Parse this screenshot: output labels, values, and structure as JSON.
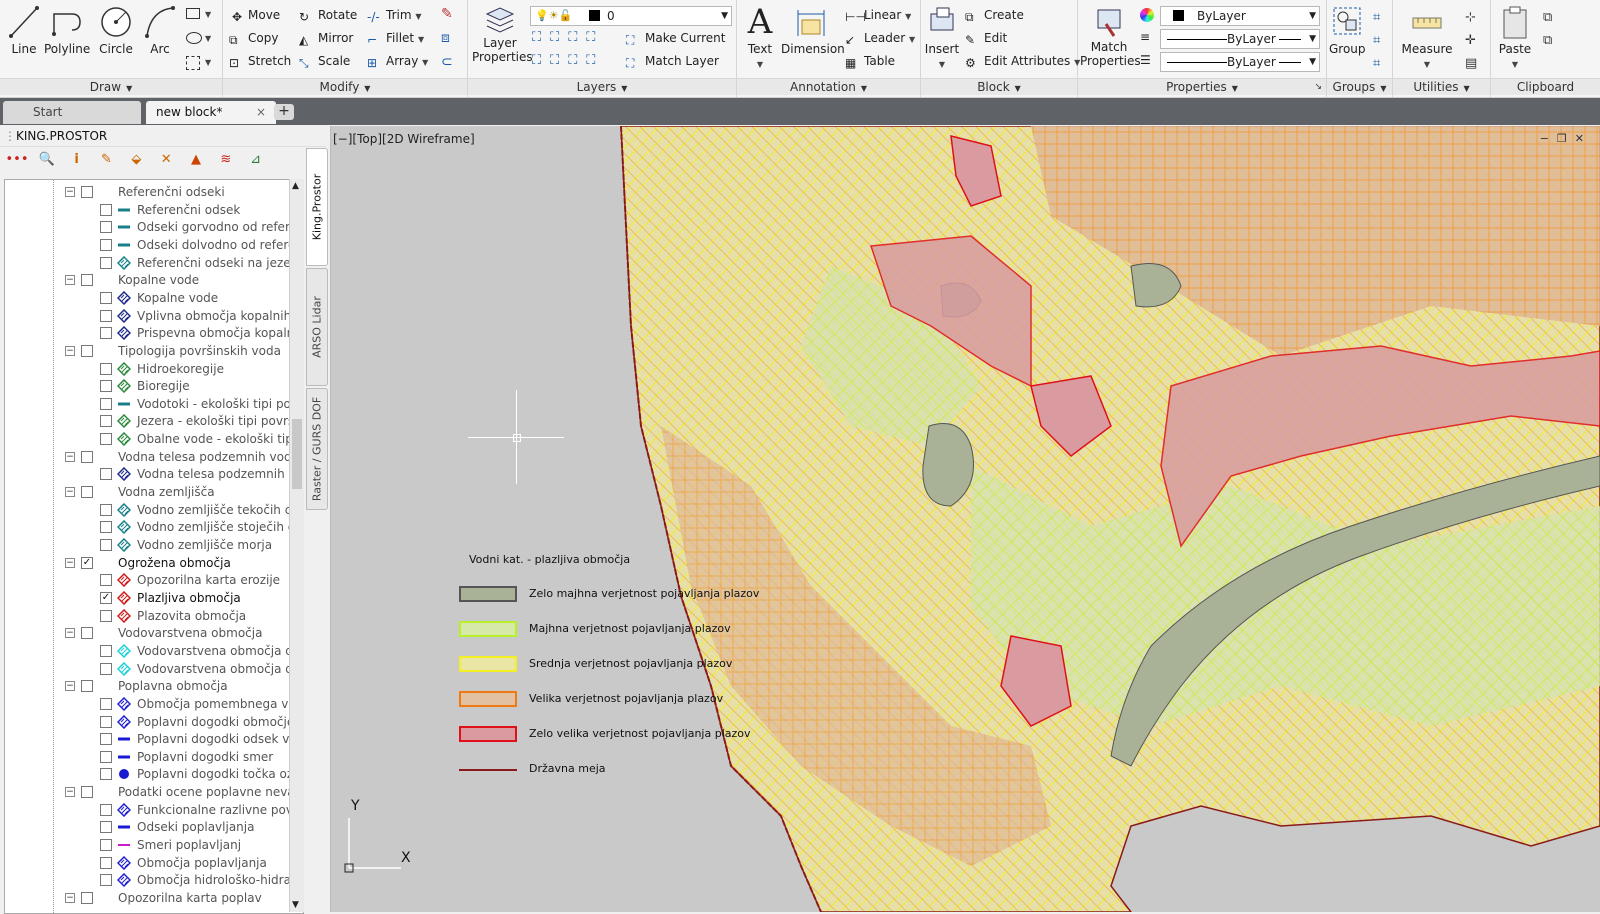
{
  "ribbon": {
    "draw": {
      "title": "Draw",
      "line": "Line",
      "polyline": "Polyline",
      "circle": "Circle",
      "arc": "Arc"
    },
    "modify": {
      "title": "Modify",
      "move": "Move",
      "rotate": "Rotate",
      "trim": "Trim",
      "copy": "Copy",
      "mirror": "Mirror",
      "fillet": "Fillet",
      "stretch": "Stretch",
      "scale": "Scale",
      "array": "Array"
    },
    "layers": {
      "title": "Layers",
      "layer_properties_1": "Layer",
      "layer_properties_2": "Properties",
      "layer_value": "0",
      "make_current": "Make Current",
      "match_layer": "Match Layer"
    },
    "annotation": {
      "title": "Annotation",
      "text": "Text",
      "dimension": "Dimension",
      "linear": "Linear",
      "leader": "Leader",
      "table": "Table"
    },
    "block": {
      "title": "Block",
      "insert": "Insert",
      "create": "Create",
      "edit": "Edit",
      "edit_attributes": "Edit Attributes"
    },
    "properties": {
      "title": "Properties",
      "match_1": "Match",
      "match_2": "Properties",
      "color": "ByLayer",
      "linetype": "ByLayer",
      "lineweight": "ByLayer"
    },
    "groups": {
      "title": "Groups",
      "group": "Group"
    },
    "utilities": {
      "title": "Utilities",
      "measure": "Measure"
    },
    "clipboard": {
      "title": "Clipboard",
      "paste": "Paste"
    }
  },
  "tabs": {
    "start": "Start",
    "new_block": "new block*",
    "close": "×",
    "plus": "+"
  },
  "left_panel": {
    "title": "KING.PROSTOR",
    "side_tabs": [
      "King.Prostor",
      "ARSO Lidar",
      "Raster / GURS DOF"
    ],
    "tree": [
      {
        "label": "Referenčni odseki",
        "level": 0,
        "checked": false,
        "icon": "none"
      },
      {
        "label": "Referenčni odsek",
        "level": 1,
        "checked": false,
        "icon": "line-teal"
      },
      {
        "label": "Odseki gorvodno od referenč",
        "level": 1,
        "checked": false,
        "icon": "line-teal"
      },
      {
        "label": "Odseki dolvodno od referenč",
        "level": 1,
        "checked": false,
        "icon": "line-teal"
      },
      {
        "label": "Referenčni odseki na jezerih",
        "level": 1,
        "checked": false,
        "icon": "hatch-teal"
      },
      {
        "label": "Kopalne vode",
        "level": 0,
        "checked": false,
        "icon": "none"
      },
      {
        "label": "Kopalne vode",
        "level": 1,
        "checked": false,
        "icon": "hatch-navy"
      },
      {
        "label": "Vplivna območja kopalnih vo",
        "level": 1,
        "checked": false,
        "icon": "hatch-navy"
      },
      {
        "label": "Prispevna območja kopalnih",
        "level": 1,
        "checked": false,
        "icon": "hatch-navy"
      },
      {
        "label": "Tipologija površinskih voda",
        "level": 0,
        "checked": false,
        "icon": "none"
      },
      {
        "label": "Hidroekoregije",
        "level": 1,
        "checked": false,
        "icon": "hatch-green"
      },
      {
        "label": "Bioregije",
        "level": 1,
        "checked": false,
        "icon": "hatch-green"
      },
      {
        "label": "Vodotoki - ekološki tipi površ",
        "level": 1,
        "checked": false,
        "icon": "line-teal"
      },
      {
        "label": "Jezera - ekološki tipi površins",
        "level": 1,
        "checked": false,
        "icon": "hatch-green"
      },
      {
        "label": "Obalne vode - ekološki tipi po",
        "level": 1,
        "checked": false,
        "icon": "hatch-green"
      },
      {
        "label": "Vodna telesa podzemnih voda",
        "level": 0,
        "checked": false,
        "icon": "none"
      },
      {
        "label": "Vodna telesa podzemnih vod",
        "level": 1,
        "checked": false,
        "icon": "hatch-navy"
      },
      {
        "label": "Vodna zemljišča",
        "level": 0,
        "checked": false,
        "icon": "none"
      },
      {
        "label": "Vodno zemljišče tekočih celin",
        "level": 1,
        "checked": false,
        "icon": "hatch-teal"
      },
      {
        "label": "Vodno zemljišče stoječih celin",
        "level": 1,
        "checked": false,
        "icon": "hatch-teal"
      },
      {
        "label": "Vodno zemljišče morja",
        "level": 1,
        "checked": false,
        "icon": "hatch-teal"
      },
      {
        "label": "Ogrožena območja",
        "level": 0,
        "checked": true,
        "icon": "none",
        "dark": true
      },
      {
        "label": "Opozorilna karta erozije",
        "level": 1,
        "checked": false,
        "icon": "hatch-red"
      },
      {
        "label": "Plazljiva območja",
        "level": 1,
        "checked": true,
        "icon": "hatch-red",
        "dark": true
      },
      {
        "label": "Plazovita območja",
        "level": 1,
        "checked": false,
        "icon": "hatch-red"
      },
      {
        "label": "Vodovarstvena območja",
        "level": 0,
        "checked": false,
        "icon": "none"
      },
      {
        "label": "Vodovarstvena območja dolo",
        "level": 1,
        "checked": false,
        "icon": "hatch-cyan"
      },
      {
        "label": "Vodovarstvena območja dolo",
        "level": 1,
        "checked": false,
        "icon": "hatch-cyan"
      },
      {
        "label": "Poplavna območja",
        "level": 0,
        "checked": false,
        "icon": "none"
      },
      {
        "label": "Območja pomembnega vpliv",
        "level": 1,
        "checked": false,
        "icon": "hatch-blue"
      },
      {
        "label": "Poplavni dogodki območje",
        "level": 1,
        "checked": false,
        "icon": "hatch-blue"
      },
      {
        "label": "Poplavni dogodki odsek vodo",
        "level": 1,
        "checked": false,
        "icon": "line-blue"
      },
      {
        "label": "Poplavni dogodki smer",
        "level": 1,
        "checked": false,
        "icon": "line-blue"
      },
      {
        "label": "Poplavni dogodki točka oz. m",
        "level": 1,
        "checked": false,
        "icon": "dot-blue"
      },
      {
        "label": "Podatki ocene poplavne nevarno",
        "level": 0,
        "checked": false,
        "icon": "none"
      },
      {
        "label": "Funkcionalne razlivne površin",
        "level": 1,
        "checked": false,
        "icon": "hatch-blue"
      },
      {
        "label": "Odseki poplavljanja",
        "level": 1,
        "checked": false,
        "icon": "line-blue"
      },
      {
        "label": "Smeri poplavljanj",
        "level": 1,
        "checked": false,
        "icon": "line-magenta"
      },
      {
        "label": "Območja poplavljanja",
        "level": 1,
        "checked": false,
        "icon": "hatch-blue"
      },
      {
        "label": "Območja hidrološko-hidravli",
        "level": 1,
        "checked": false,
        "icon": "hatch-blue"
      },
      {
        "label": "Opozorilna karta poplav",
        "level": 0,
        "checked": false,
        "icon": "none"
      }
    ]
  },
  "viewport": {
    "label": "[−][Top][2D Wireframe]",
    "axis_y": "Y",
    "axis_x": "X",
    "legend": {
      "title": "Vodni kat. - plazljiva območja",
      "items": [
        {
          "label": "Zelo majhna verjetnost pojavljanja plazov",
          "fill": "#a9b296",
          "stroke": "#555555"
        },
        {
          "label": "Majhna verjetnost pojavljanja plazov",
          "fill": "#d7e9a9",
          "stroke": "#b8f02a"
        },
        {
          "label": "Srednja verjetnost pojavljanja plazov",
          "fill": "#e9e6a6",
          "stroke": "#f2ef22"
        },
        {
          "label": "Velika verjetnost pojavljanja plazov",
          "fill": "#e2c0a2",
          "stroke": "#f07a12"
        },
        {
          "label": "Zelo velika verjetnost pojavljanja plazov",
          "fill": "#d99ba0",
          "stroke": "#e0101a"
        },
        {
          "label": "Državna meja",
          "fill": "none",
          "stroke": "#8a1a1a"
        }
      ]
    }
  }
}
